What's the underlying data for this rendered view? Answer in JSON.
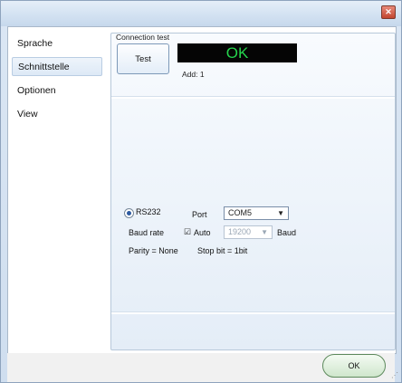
{
  "window": {
    "close_icon": "close-x-icon"
  },
  "sidebar": {
    "items": [
      {
        "label": "Sprache"
      },
      {
        "label": "Schnittstelle"
      },
      {
        "label": "Optionen"
      },
      {
        "label": "View"
      }
    ]
  },
  "connection": {
    "group_title": "Connection test",
    "test_label": "Test",
    "status_text": "OK",
    "address_text": "Add: 1"
  },
  "serial": {
    "interface_label": "RS232",
    "port_label": "Port",
    "port_value": "COM5",
    "baud_rate_label": "Baud rate",
    "auto_label": "Auto",
    "baud_value": "19200",
    "baud_unit": "Baud",
    "parity_text": "Parity = None",
    "stop_bit_text": "Stop bit = 1bit"
  },
  "footer": {
    "ok_label": "OK"
  },
  "colors": {
    "status_text": "#25d44d",
    "status_background": "#050505"
  }
}
